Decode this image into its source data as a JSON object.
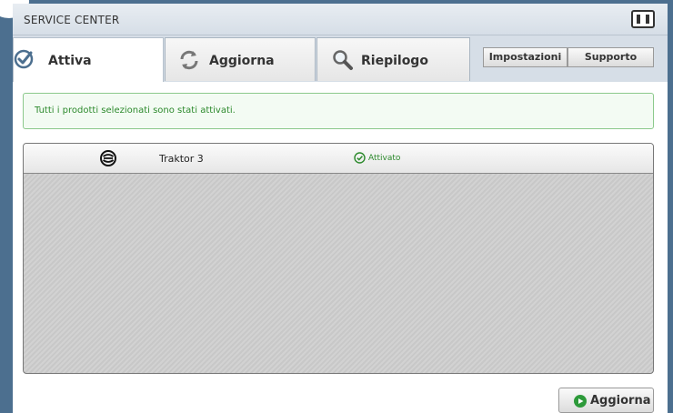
{
  "window": {
    "title": "SERVICE CENTER"
  },
  "tabs": [
    {
      "label": "Attiva",
      "icon": "check-badge-icon",
      "active": true
    },
    {
      "label": "Aggiorna",
      "icon": "refresh-icon",
      "active": false
    },
    {
      "label": "Riepilogo",
      "icon": "magnifier-icon",
      "active": false
    }
  ],
  "header_buttons": {
    "settings": "Impostazioni",
    "support": "Supporto"
  },
  "message": "Tutti i prodotti selezionati sono stati attivati.",
  "products": [
    {
      "name": "Traktor 3",
      "status": "Attivato",
      "icon": "traktor-icon",
      "status_icon": "check-circle-icon"
    }
  ],
  "footer": {
    "refresh_label": "Aggiorna",
    "refresh_icon": "play-circle-icon"
  },
  "colors": {
    "frame": "#4c6f8f",
    "success": "#2d8a2d",
    "success_border": "#8cc98c"
  }
}
